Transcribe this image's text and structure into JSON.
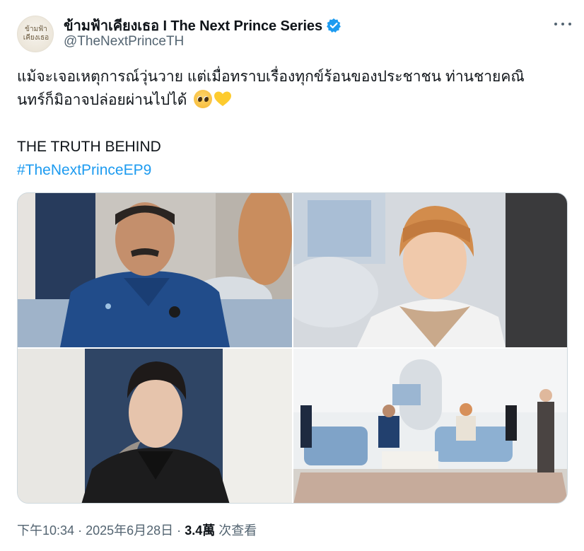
{
  "post": {
    "display_name": "ข้ามฟ้าเคียงเธอ I The Next Prince Series",
    "handle": "@TheNextPrinceTH",
    "avatar_text": "ข้ามฟ้าเคียงเธอ",
    "text_line1": "แม้จะเจอเหตุการณ์วุ่นวาย แต่เมื่อทราบเรื่องทุกข์ร้อนของประชาชน ท่านชายคณิ",
    "text_line2": "นทร์ก็มิอาจปล่อยผ่านไปได้",
    "text_line3": "THE TRUTH BEHIND",
    "hashtag": "#TheNextPrinceEP9",
    "emojis": [
      "pleading-face",
      "yellow-heart"
    ],
    "accent_color": "#1d9bf0"
  },
  "media": {
    "images": [
      "photo-1",
      "photo-2",
      "photo-3",
      "photo-4"
    ]
  },
  "meta": {
    "time": "下午10:34",
    "date": "2025年6月28日",
    "sep1": "·",
    "sep2": "·",
    "views_count": "3.4萬",
    "views_label": "次查看"
  }
}
